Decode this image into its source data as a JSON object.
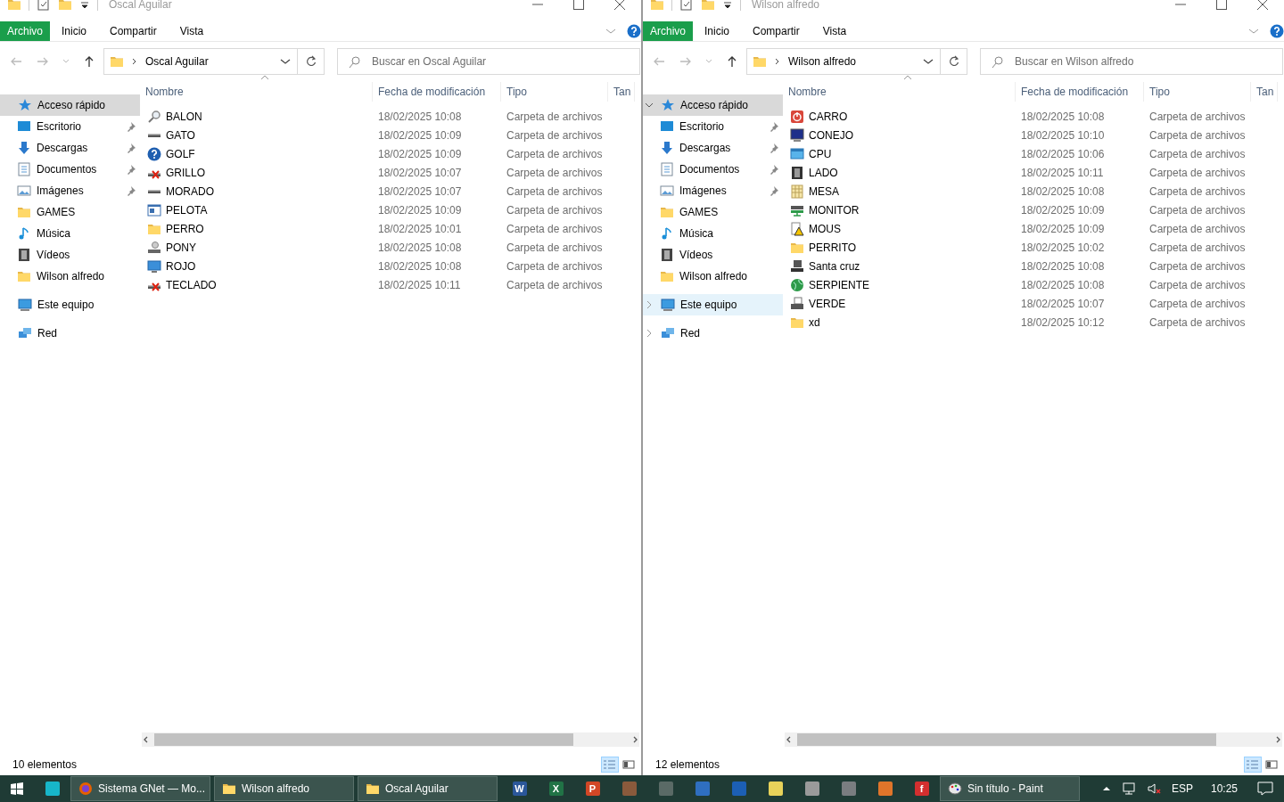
{
  "windows": [
    {
      "title": "Oscal Aguilar",
      "ribbon_tabs": [
        {
          "label": "Archivo",
          "kind": "file"
        },
        {
          "label": "Inicio",
          "kind": "tab"
        },
        {
          "label": "Compartir",
          "kind": "tab"
        },
        {
          "label": "Vista",
          "kind": "tab"
        }
      ],
      "address": "Oscal Aguilar",
      "search_placeholder": "Buscar en Oscal Aguilar",
      "columns": [
        "Nombre",
        "Fecha de modificación",
        "Tipo",
        "Tan"
      ],
      "nav": [
        {
          "label": "Acceso rápido",
          "kind": "star",
          "selected": true,
          "hovered": false,
          "children": [
            {
              "label": "Escritorio",
              "kind": "desktop",
              "pinned": true
            },
            {
              "label": "Descargas",
              "kind": "download",
              "pinned": true
            },
            {
              "label": "Documentos",
              "kind": "document",
              "pinned": true
            },
            {
              "label": "Imágenes",
              "kind": "pictures",
              "pinned": true
            },
            {
              "label": "GAMES",
              "kind": "folder",
              "pinned": false
            },
            {
              "label": "Música",
              "kind": "music",
              "pinned": false
            },
            {
              "label": "Vídeos",
              "kind": "video",
              "pinned": false
            },
            {
              "label": "Wilson alfredo",
              "kind": "folder",
              "pinned": false
            }
          ]
        },
        {
          "label": "Este equipo",
          "kind": "pc",
          "selected": false,
          "hovered": false
        },
        {
          "label": "Red",
          "kind": "network",
          "selected": false,
          "hovered": false
        }
      ],
      "files": [
        {
          "name": "BALON",
          "date": "18/02/2025 10:08",
          "type": "Carpeta de archivos",
          "kind": "magnifier"
        },
        {
          "name": "GATO",
          "date": "18/02/2025 10:09",
          "type": "Carpeta de archivos",
          "kind": "drive"
        },
        {
          "name": "GOLF",
          "date": "18/02/2025 10:09",
          "type": "Carpeta de archivos",
          "kind": "help"
        },
        {
          "name": "GRILLO",
          "date": "18/02/2025 10:07",
          "type": "Carpeta de archivos",
          "kind": "drive-x"
        },
        {
          "name": "MORADO",
          "date": "18/02/2025 10:07",
          "type": "Carpeta de archivos",
          "kind": "drive"
        },
        {
          "name": "PELOTA",
          "date": "18/02/2025 10:09",
          "type": "Carpeta de archivos",
          "kind": "window"
        },
        {
          "name": "PERRO",
          "date": "18/02/2025 10:01",
          "type": "Carpeta de archivos",
          "kind": "folder"
        },
        {
          "name": "PONY",
          "date": "18/02/2025 10:08",
          "type": "Carpeta de archivos",
          "kind": "drive-user"
        },
        {
          "name": "ROJO",
          "date": "18/02/2025 10:08",
          "type": "Carpeta de archivos",
          "kind": "monitor"
        },
        {
          "name": "TECLADO",
          "date": "18/02/2025 10:11",
          "type": "Carpeta de archivos",
          "kind": "drive-x"
        }
      ],
      "status": "10 elementos"
    },
    {
      "title": "Wilson alfredo",
      "ribbon_tabs": [
        {
          "label": "Archivo",
          "kind": "file"
        },
        {
          "label": "Inicio",
          "kind": "tab"
        },
        {
          "label": "Compartir",
          "kind": "tab"
        },
        {
          "label": "Vista",
          "kind": "tab"
        }
      ],
      "address": "Wilson alfredo",
      "search_placeholder": "Buscar en Wilson alfredo",
      "columns": [
        "Nombre",
        "Fecha de modificación",
        "Tipo",
        "Tan"
      ],
      "nav": [
        {
          "label": "Acceso rápido",
          "kind": "star",
          "selected": true,
          "hovered": false,
          "expanded": true,
          "children": [
            {
              "label": "Escritorio",
              "kind": "desktop",
              "pinned": true
            },
            {
              "label": "Descargas",
              "kind": "download",
              "pinned": true
            },
            {
              "label": "Documentos",
              "kind": "document",
              "pinned": true
            },
            {
              "label": "Imágenes",
              "kind": "pictures",
              "pinned": true
            },
            {
              "label": "GAMES",
              "kind": "folder",
              "pinned": false
            },
            {
              "label": "Música",
              "kind": "music",
              "pinned": false
            },
            {
              "label": "Vídeos",
              "kind": "video",
              "pinned": false
            },
            {
              "label": "Wilson alfredo",
              "kind": "folder",
              "pinned": false
            }
          ]
        },
        {
          "label": "Este equipo",
          "kind": "pc",
          "selected": false,
          "hovered": true,
          "expanded": false
        },
        {
          "label": "Red",
          "kind": "network",
          "selected": false,
          "hovered": false,
          "expanded": false
        }
      ],
      "files": [
        {
          "name": "CARRO",
          "date": "18/02/2025 10:08",
          "type": "Carpeta de archivos",
          "kind": "power"
        },
        {
          "name": "CONEJO",
          "date": "18/02/2025 10:10",
          "type": "Carpeta de archivos",
          "kind": "monitor-dark"
        },
        {
          "name": "CPU",
          "date": "18/02/2025 10:06",
          "type": "Carpeta de archivos",
          "kind": "screen"
        },
        {
          "name": "LADO",
          "date": "18/02/2025 10:11",
          "type": "Carpeta de archivos",
          "kind": "film"
        },
        {
          "name": "MESA",
          "date": "18/02/2025 10:08",
          "type": "Carpeta de archivos",
          "kind": "grid"
        },
        {
          "name": "MONITOR",
          "date": "18/02/2025 10:09",
          "type": "Carpeta de archivos",
          "kind": "network-drive"
        },
        {
          "name": "MOUS",
          "date": "18/02/2025 10:09",
          "type": "Carpeta de archivos",
          "kind": "warning"
        },
        {
          "name": "PERRITO",
          "date": "18/02/2025 10:02",
          "type": "Carpeta de archivos",
          "kind": "folder"
        },
        {
          "name": "Santa cruz",
          "date": "18/02/2025 10:08",
          "type": "Carpeta de archivos",
          "kind": "computer"
        },
        {
          "name": "SERPIENTE",
          "date": "18/02/2025 10:08",
          "type": "Carpeta de archivos",
          "kind": "globe"
        },
        {
          "name": "VERDE",
          "date": "18/02/2025 10:07",
          "type": "Carpeta de archivos",
          "kind": "printer"
        },
        {
          "name": "xd",
          "date": "18/02/2025 10:12",
          "type": "Carpeta de archivos",
          "kind": "folder"
        }
      ],
      "status": "12 elementos"
    }
  ],
  "taskbar": {
    "items": [
      {
        "kind": "start"
      },
      {
        "kind": "tile",
        "color": "#17b6c9"
      },
      {
        "kind": "browser",
        "label": "Sistema GNet — Mo..."
      },
      {
        "kind": "folder",
        "label": "Wilson alfredo"
      },
      {
        "kind": "folder",
        "label": "Oscal Aguilar"
      },
      {
        "kind": "tile",
        "color": "#2b579a",
        "glyph": "W"
      },
      {
        "kind": "tile",
        "color": "#217346",
        "glyph": "X"
      },
      {
        "kind": "tile",
        "color": "#d24726",
        "glyph": "P"
      },
      {
        "kind": "tile",
        "color": "#8a5a3c"
      },
      {
        "kind": "tile",
        "color": "#5a6a66"
      },
      {
        "kind": "tile",
        "color": "#2f6fc0"
      },
      {
        "kind": "tile",
        "color": "#1c5fb4"
      },
      {
        "kind": "tile",
        "color": "#e8d25a"
      },
      {
        "kind": "tile",
        "color": "#9a9a9a"
      },
      {
        "kind": "tile",
        "color": "#7a7d80"
      },
      {
        "kind": "tile",
        "color": "#e0752a"
      },
      {
        "kind": "tile",
        "color": "#d32f2f",
        "glyph": "f"
      },
      {
        "kind": "paint",
        "label": "Sin título - Paint"
      }
    ],
    "language": "ESP",
    "time": "10:25"
  }
}
